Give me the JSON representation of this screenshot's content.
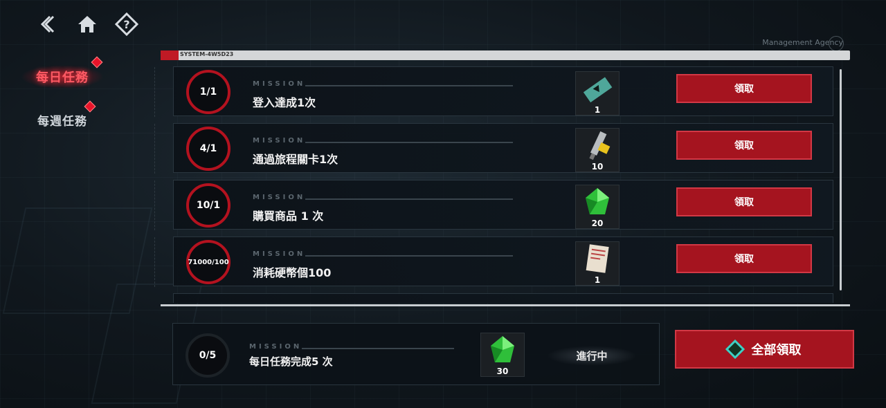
{
  "nav": {
    "back_icon": "back-chevron-icon",
    "home_icon": "home-icon",
    "help_icon": "help-icon"
  },
  "tabs": [
    {
      "label": "每日任務",
      "active": true
    },
    {
      "label": "每週任務",
      "active": false
    }
  ],
  "header": {
    "system_code": "SYSTEM-4W5D23",
    "agency": "Management Agency"
  },
  "mission_label": "MISSION",
  "missions": [
    {
      "progress": "1/1",
      "title": "登入達成1次",
      "reward_icon": "ticket-icon",
      "reward_qty": "1",
      "button": "領取"
    },
    {
      "progress": "4/1",
      "title": "通過旅程關卡1次",
      "reward_icon": "syringe-icon",
      "reward_qty": "10",
      "button": "領取"
    },
    {
      "progress": "10/1",
      "title": "購買商品 1 次",
      "reward_icon": "green-crystal-icon",
      "reward_qty": "20",
      "button": "領取"
    },
    {
      "progress": "71000/100",
      "title": "消耗硬幣個100",
      "reward_icon": "document-icon",
      "reward_qty": "1",
      "button": "領取"
    }
  ],
  "summary": {
    "progress": "0/5",
    "title": "每日任務完成5 次",
    "reward_icon": "green-crystal-icon",
    "reward_qty": "30",
    "status": "進行中"
  },
  "claim_all": "全部領取",
  "colors": {
    "accent_red": "#a5141f",
    "ring_red": "#b4121f",
    "teal": "#3fd0c4"
  }
}
